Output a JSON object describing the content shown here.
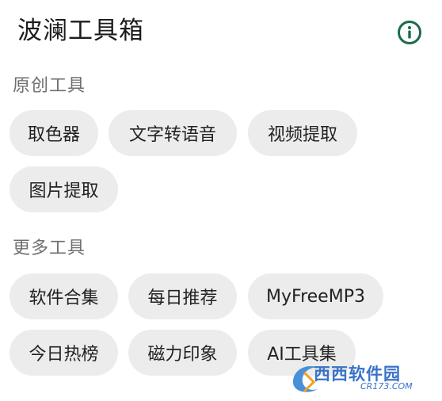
{
  "app_title": "波澜工具箱",
  "icons": {
    "info": "info-icon"
  },
  "colors": {
    "accent": "#1b6b4a",
    "chip_bg": "#ececec",
    "section_title": "#6f6f6f"
  },
  "sections": [
    {
      "title": "原创工具",
      "chips": [
        "取色器",
        "文字转语音",
        "视频提取",
        "图片提取"
      ]
    },
    {
      "title": "更多工具",
      "chips": [
        "软件合集",
        "每日推荐",
        "MyFreeMP3",
        "今日热榜",
        "磁力印象",
        "AI工具集"
      ]
    }
  ],
  "watermark": {
    "text": "西西软件园",
    "sub": "CR173.COM"
  }
}
